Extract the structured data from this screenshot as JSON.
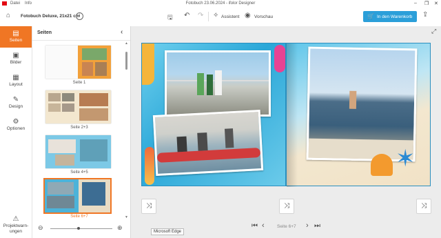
{
  "titlebar": {
    "menu_file": "Datei",
    "menu_info": "Info",
    "window_title": "Fotobuch 23.06.2024 - ifolor Designer"
  },
  "toolbar": {
    "product_name": "Fotobuch Deluxe, 21x21 cm",
    "assistant_label": "Assistent",
    "preview_label": "Vorschau",
    "cart_label": "In den Warenkorb"
  },
  "rail": {
    "items": [
      {
        "label": "Seiten",
        "icon": "pages-icon"
      },
      {
        "label": "Bilder",
        "icon": "images-icon"
      },
      {
        "label": "Layout",
        "icon": "layout-icon"
      },
      {
        "label": "Design",
        "icon": "design-icon"
      },
      {
        "label": "Optionen",
        "icon": "options-icon"
      }
    ],
    "warnings_label_1": "Projektwarn-",
    "warnings_label_2": "ungen"
  },
  "panel": {
    "title": "Seiten",
    "thumbs": [
      {
        "caption": "Seite 1"
      },
      {
        "caption": "Seite 2+3"
      },
      {
        "caption": "Seite 4+5"
      },
      {
        "caption": "Seite 6+7"
      }
    ]
  },
  "nav": {
    "current_page": "Seite 6+7"
  },
  "tooltip": "Microsoft Edge",
  "colors": {
    "accent": "#f07624",
    "cart": "#2b9fd9",
    "brand": "#e30613"
  }
}
